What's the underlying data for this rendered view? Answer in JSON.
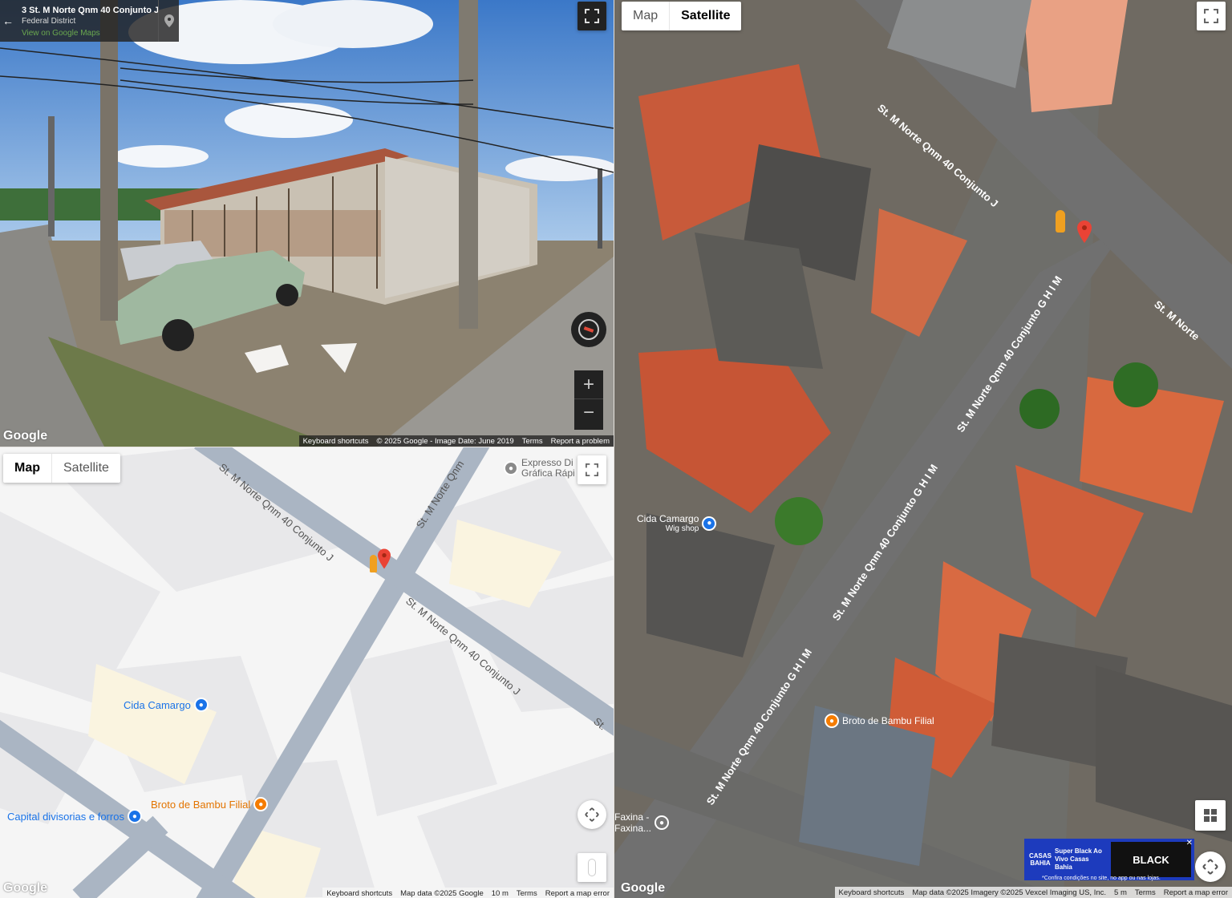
{
  "streetview": {
    "address_title": "3 St. M Norte Qnm 40 Conjunto J",
    "address_sub": "Federal District",
    "view_link": "View on Google Maps",
    "back_icon": "arrow-left-icon",
    "footer": [
      "Keyboard shortcuts",
      "© 2025 Google - Image Date: June 2019",
      "Terms",
      "Report a problem"
    ],
    "logo": "Google"
  },
  "right_map": {
    "types": [
      "Map",
      "Satellite"
    ],
    "active_type": "Satellite",
    "streets": [
      "St. M Norte Qnm 40 Conjunto J",
      "St. M Norte Qnm 40 Conjunto G H I M",
      "St. M Norte Qnm 40 Conjunto G H I M",
      "St. M Norte Qnm 40 Conjunto G H I M",
      "St. M Norte"
    ],
    "pois": [
      {
        "name": "Cida Camargo",
        "sub": "Wig shop"
      },
      {
        "name": "Broto de Bambu Filial"
      },
      {
        "name": "Faxina -",
        "sub": "Faxina..."
      }
    ],
    "ad": {
      "brand": "CASAS BAHIA",
      "title": "Super Black Ao Vivo Casas Bahia",
      "badge": "BLACK",
      "note": "*Confira condições no site, no app ou nas lojas."
    },
    "footer": [
      "Keyboard shortcuts",
      "Map data ©2025 Imagery ©2025 Vexcel Imaging US, Inc.",
      "5 m",
      "Terms",
      "Report a map error"
    ],
    "logo": "Google"
  },
  "bottom_map": {
    "types": [
      "Map",
      "Satellite"
    ],
    "active_type": "Map",
    "streets": [
      "St. M Norte Qnm 40 Conjunto J",
      "St. M Norte Qnm 40 Conjunto J",
      "St. M Norte Qnm",
      "St."
    ],
    "pois": [
      {
        "name": "Expresso Di",
        "sub": "Gráfica Rápi"
      },
      {
        "name": "Cida Camargo"
      },
      {
        "name": "Broto de Bambu Filial"
      },
      {
        "name": "Capital divisorias e forros"
      }
    ],
    "footer": [
      "Keyboard shortcuts",
      "Map data ©2025 Google",
      "10 m",
      "Terms",
      "Report a map error"
    ],
    "logo": "Google"
  }
}
